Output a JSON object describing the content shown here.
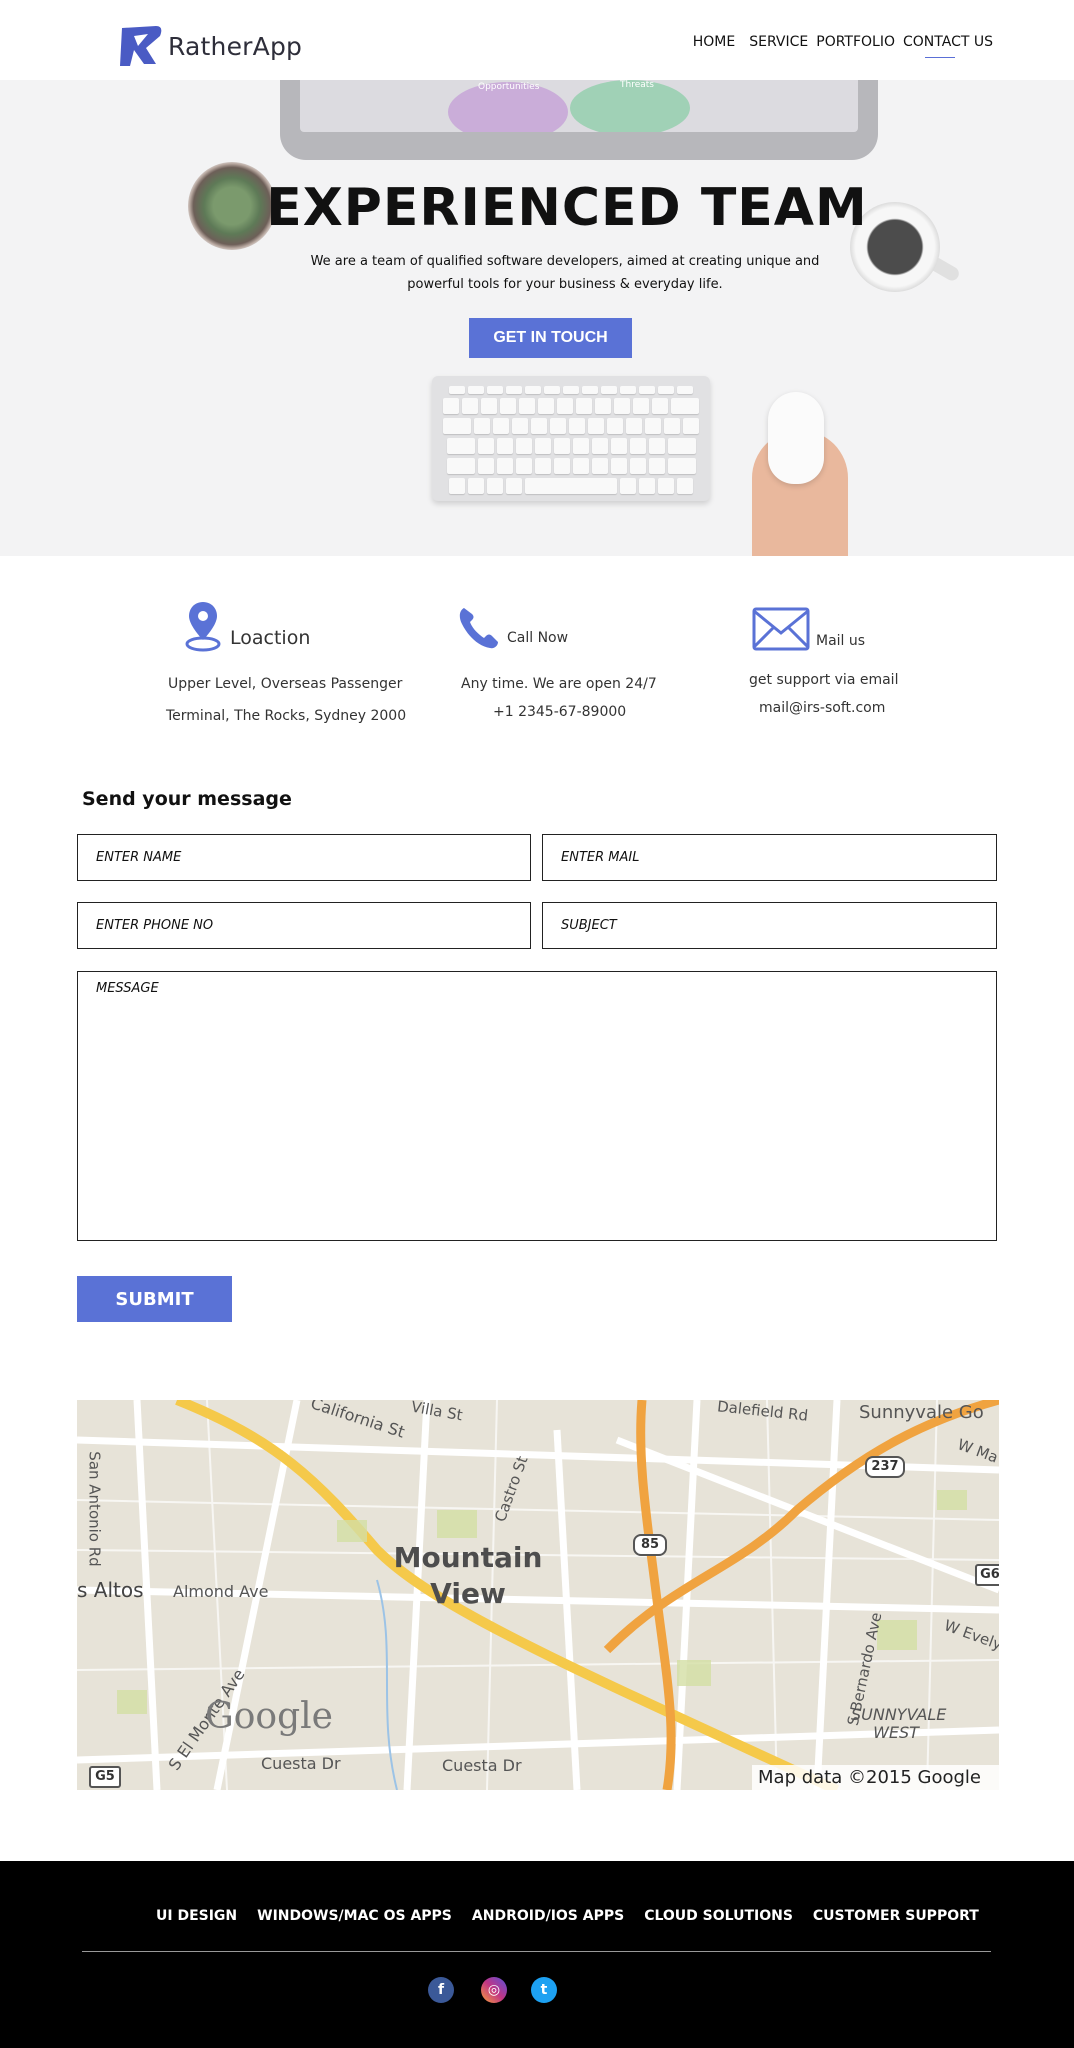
{
  "header": {
    "logo_text": "RatherApp",
    "nav": [
      {
        "label": "HOME"
      },
      {
        "label": "SERVICE"
      },
      {
        "label": "PORTFOLIO"
      },
      {
        "label": "CONTACT US",
        "active": true
      }
    ]
  },
  "hero": {
    "title": "EXPERIENCED TEAM",
    "subtitle": "We are a team of qualified software developers, aimed at creating unique and powerful tools for your business & everyday life.",
    "cta": "GET IN TOUCH",
    "monitor_labels": [
      "Opportunities",
      "Threats"
    ]
  },
  "contact_info": {
    "location": {
      "label": "Loaction",
      "lines": [
        "Upper Level, Overseas Passenger",
        "Terminal, The Rocks, Sydney 2000"
      ]
    },
    "phone": {
      "label": "Call Now",
      "lines": [
        "Any time. We are open 24/7",
        "+1 2345-67-89000"
      ]
    },
    "mail": {
      "label": "Mail us",
      "lines": [
        "get support via email",
        "mail@irs-soft.com"
      ]
    }
  },
  "form": {
    "title": "Send your message",
    "name_placeholder": "ENTER NAME",
    "mail_placeholder": "ENTER MAIL",
    "phone_placeholder": "ENTER PHONE NO",
    "subject_placeholder": "SUBJECT",
    "message_placeholder": "MESSAGE",
    "submit": "SUBMIT"
  },
  "map": {
    "city": "Mountain View",
    "streets": [
      "California St",
      "Villa St",
      "Castro St",
      "San Antonio Rd",
      "Almond Ave",
      "S El Monte Ave",
      "Cuesta Dr",
      "Cuesta Dr",
      "Sunnyvale Go",
      "W Ma",
      "W Evely",
      "S Bernardo Ave",
      "SUNNYVALE WEST",
      "Dalefield Rd"
    ],
    "places": [
      "s Altos"
    ],
    "routes": [
      "237",
      "85",
      "G5",
      "G6"
    ],
    "logo": "Google",
    "credit": "Map data ©2015 Google",
    "colors": {
      "highway": "#f0a340",
      "major_road": "#f5c94a"
    }
  },
  "footer": {
    "links": [
      "UI DESIGN",
      "WINDOWS/MAC OS APPS",
      "ANDROID/IOS APPS",
      "CLOUD SOLUTIONS",
      "CUSTOMER SUPPORT"
    ],
    "social": [
      {
        "icon": "facebook-icon",
        "glyph": "f",
        "color": "#3b5998"
      },
      {
        "icon": "instagram-icon",
        "glyph": "◎",
        "color": "#c13584"
      },
      {
        "icon": "twitter-icon",
        "glyph": "t",
        "color": "#1da1f2"
      }
    ]
  },
  "accent_color": "#5a72d6"
}
